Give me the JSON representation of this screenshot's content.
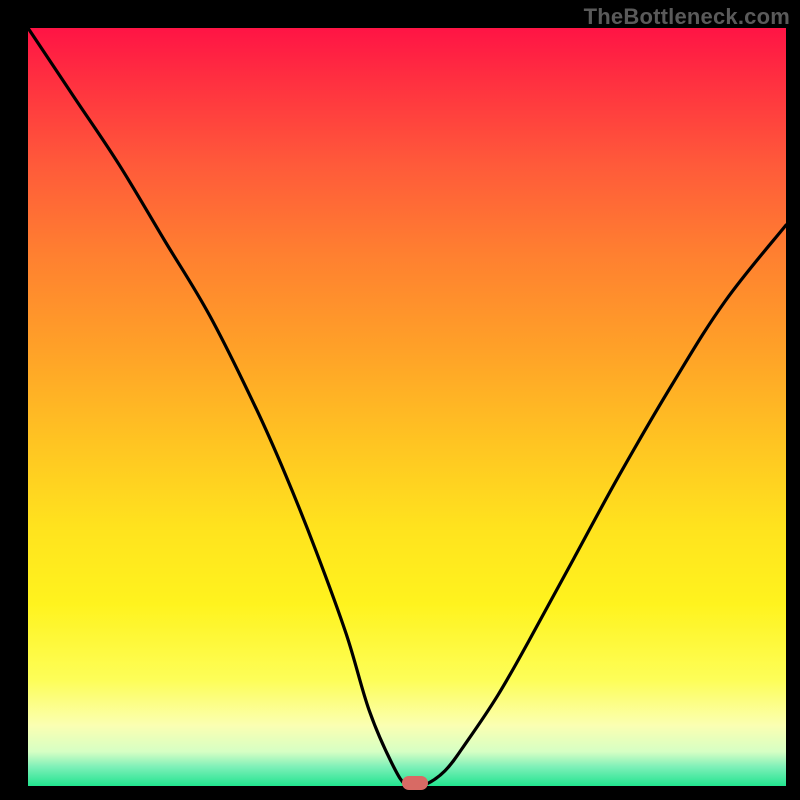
{
  "attribution": "TheBottleneck.com",
  "chart_data": {
    "type": "line",
    "title": "",
    "xlabel": "",
    "ylabel": "",
    "xlim": [
      0,
      100
    ],
    "ylim": [
      0,
      100
    ],
    "series": [
      {
        "name": "curve",
        "x": [
          0,
          6,
          12,
          18,
          24,
          30,
          34,
          38,
          42,
          45,
          48,
          50,
          52,
          55,
          58,
          62,
          66,
          72,
          78,
          85,
          92,
          100
        ],
        "y": [
          100,
          91,
          82,
          72,
          62,
          50,
          41,
          31,
          20,
          10,
          3,
          0,
          0,
          2,
          6,
          12,
          19,
          30,
          41,
          53,
          64,
          74
        ]
      }
    ],
    "marker": {
      "x": 51,
      "y": 0
    },
    "background_gradient": {
      "top": "#ff1445",
      "mid": "#ffe31e",
      "bottom": "#22e48f"
    }
  }
}
